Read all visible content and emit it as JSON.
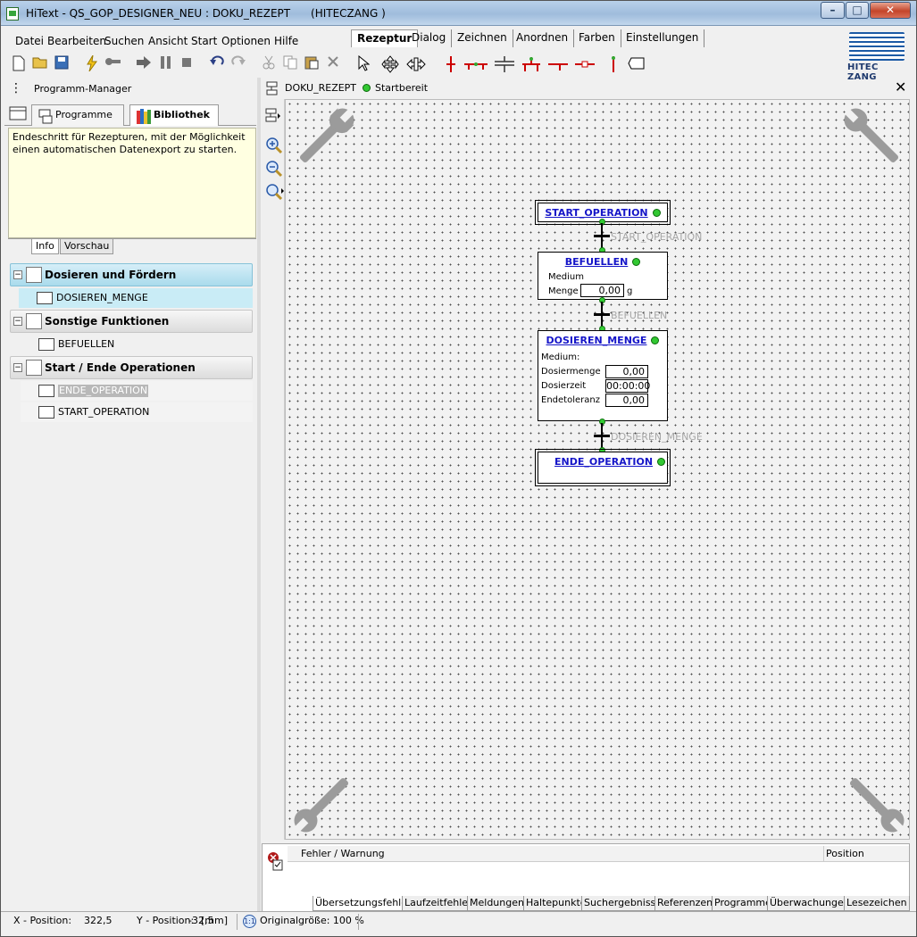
{
  "window": {
    "title": "HiText - QS_GOP_DESIGNER_NEU : DOKU_REZEPT      (HITECZANG )",
    "minimize": "–",
    "maximize": "□",
    "close": "✕"
  },
  "menu": [
    "Datei",
    "Bearbeiten",
    "Suchen",
    "Ansicht",
    "Start",
    "Optionen",
    "Hilfe"
  ],
  "ribbon_tabs": [
    "Rezeptur",
    "Dialog",
    "Zeichnen",
    "Anordnen",
    "Farben",
    "Einstellungen"
  ],
  "logo_text": "HITEC ZANG",
  "left_panel": {
    "title": "Programm-Manager",
    "tab_programs": "Programme",
    "tab_library": "Bibliothek",
    "info_text": "Endeschritt für Rezepturen, mit der Möglichkeit einen automatischen Datenexport zu starten.",
    "info_tab": "Info",
    "preview_tab": "Vorschau",
    "groups": [
      {
        "label": "Dosieren und Fördern",
        "items": [
          "DOSIEREN_MENGE"
        ]
      },
      {
        "label": "Sonstige Funktionen",
        "items": [
          "BEFUELLEN"
        ]
      },
      {
        "label": "Start / Ende Operationen",
        "items": [
          "ENDE_OPERATION",
          "START_OPERATION"
        ]
      }
    ]
  },
  "document": {
    "tab_name": "DOKU_REZEPT",
    "status": "Startbereit"
  },
  "diagram": {
    "start": {
      "title": "START_OPERATION"
    },
    "t1_label": "START_OPERATION",
    "befuellen": {
      "title": "BEFUELLEN",
      "medium_label": "Medium",
      "menge_label": "Menge",
      "menge_value": "0,00",
      "unit": "g"
    },
    "t2_label": "BEFUELLEN",
    "dosieren": {
      "title": "DOSIEREN_MENGE",
      "medium_label": "Medium:",
      "rows": [
        {
          "label": "Dosiermenge",
          "value": "0,00"
        },
        {
          "label": "Dosierzeit",
          "value": "00:00:00"
        },
        {
          "label": "Endetoleranz",
          "value": "0,00"
        }
      ]
    },
    "t3_label": "DOSIEREN_MENGE",
    "ende": {
      "title": "ENDE_OPERATION"
    }
  },
  "errors": {
    "col_message": "Fehler / Warnung",
    "col_position": "Position",
    "tabs": [
      "Übersetzungsfehler",
      "Laufzeitfehler",
      "Meldungen",
      "Haltepunkte",
      "Suchergebnisse",
      "Referenzen",
      "Programme",
      "Überwachungen",
      "Lesezeichen"
    ]
  },
  "status_bar": {
    "x_label": "X - Position:",
    "x_value": "322,5",
    "y_label": "Y - Position:",
    "y_value": "-32,5",
    "unit": "[mm]",
    "zoom_badge": "1:1",
    "zoom_text": "Originalgröße: 100 %"
  },
  "colors": {
    "node_title": "#1515c8",
    "status_dot": "#32c832",
    "connector_label": "#a6a6a6",
    "selected_group": "#a9dbec"
  }
}
